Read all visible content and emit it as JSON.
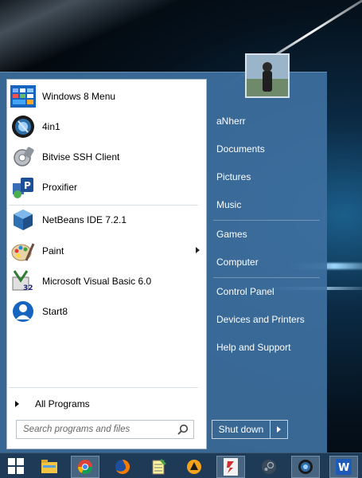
{
  "programs": [
    {
      "label": "Windows 8 Menu",
      "icon": "windows8-menu-icon",
      "submenu": false
    },
    {
      "label": "4in1",
      "icon": "4in1-icon",
      "submenu": false
    },
    {
      "label": "Bitvise SSH Client",
      "icon": "bitvise-icon",
      "submenu": false
    },
    {
      "label": "Proxifier",
      "icon": "proxifier-icon",
      "submenu": false
    },
    {
      "label": "NetBeans IDE 7.2.1",
      "icon": "netbeans-icon",
      "submenu": false
    },
    {
      "label": "Paint",
      "icon": "paint-icon",
      "submenu": true
    },
    {
      "label": "Microsoft Visual Basic 6.0",
      "icon": "visual-basic-icon",
      "submenu": false
    },
    {
      "label": "Start8",
      "icon": "start8-icon",
      "submenu": false
    }
  ],
  "all_programs_label": "All Programs",
  "search": {
    "placeholder": "Search programs and files"
  },
  "right_panel": {
    "user": "aNherr",
    "items": [
      "Documents",
      "Pictures",
      "Music",
      "Games",
      "Computer",
      "Control Panel",
      "Devices and Printers",
      "Help and Support"
    ]
  },
  "shutdown": {
    "label": "Shut down"
  },
  "taskbar": {
    "items": [
      "start-button",
      "file-explorer-icon",
      "chrome-icon",
      "firefox-icon",
      "notepad-icon",
      "vlc-icon",
      "filezilla-icon",
      "steam-icon",
      "4in1-taskbar-icon",
      "word-icon"
    ]
  },
  "colors": {
    "menu_background": "#3e70a0",
    "taskbar": "#1e3a56",
    "left_panel": "#ffffff"
  }
}
